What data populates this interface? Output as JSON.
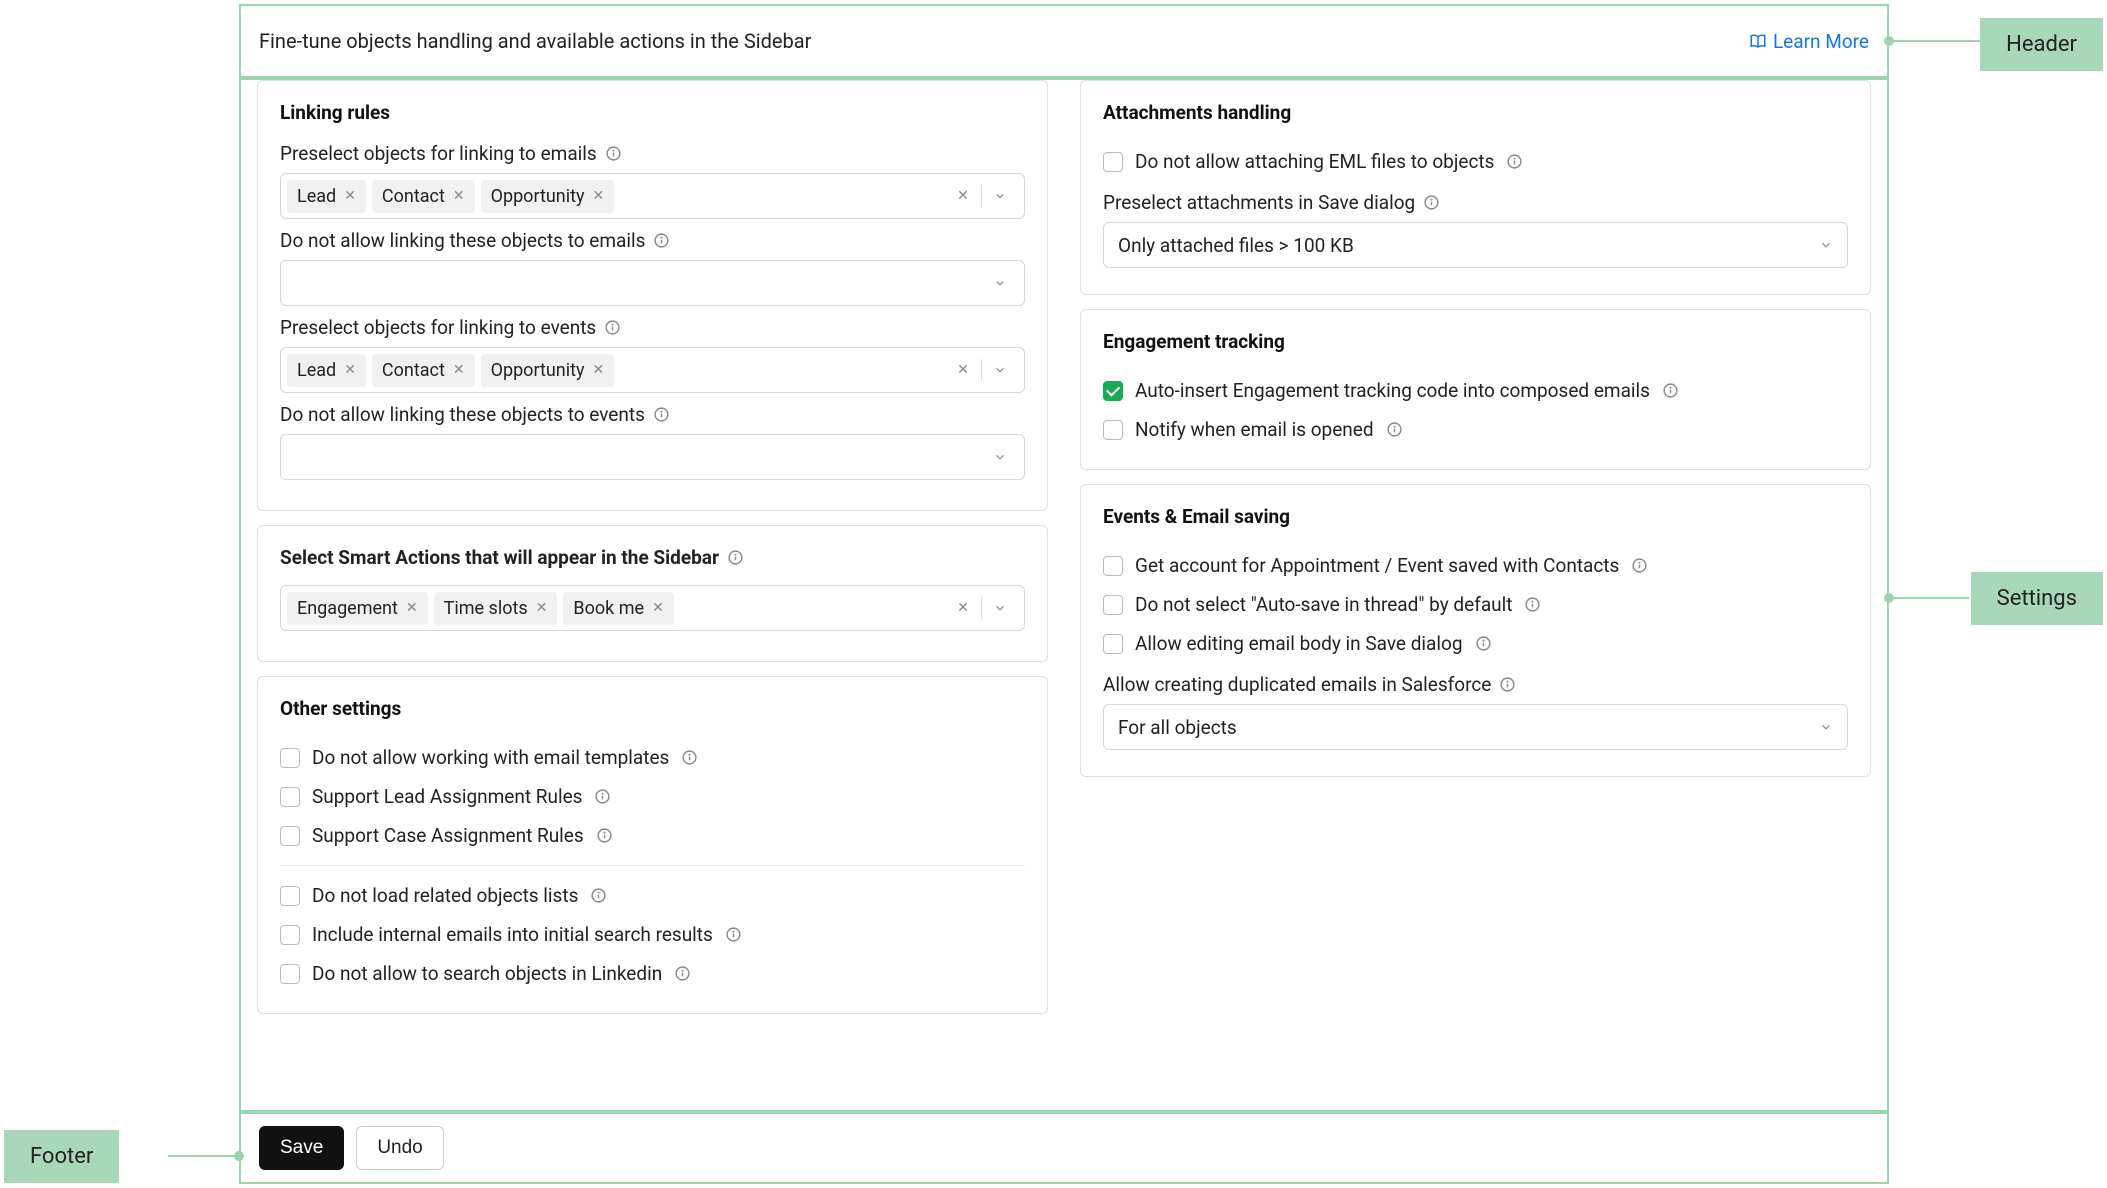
{
  "header": {
    "title": "Fine-tune objects handling and available actions in the Sidebar",
    "learn_more": "Learn More"
  },
  "callouts": {
    "header": "Header",
    "settings": "Settings",
    "footer": "Footer"
  },
  "linking": {
    "title": "Linking rules",
    "preselect_emails_label": "Preselect objects for linking to emails",
    "preselect_emails_tags": [
      "Lead",
      "Contact",
      "Opportunity"
    ],
    "disallow_emails_label": "Do not allow linking these objects to emails",
    "preselect_events_label": "Preselect objects for linking to events",
    "preselect_events_tags": [
      "Lead",
      "Contact",
      "Opportunity"
    ],
    "disallow_events_label": "Do not allow linking these objects to events"
  },
  "smart_actions": {
    "title": "Select Smart Actions that will appear in the Sidebar",
    "tags": [
      "Engagement",
      "Time slots",
      "Book me"
    ]
  },
  "other": {
    "title": "Other settings",
    "templates": "Do not allow working with email templates",
    "lead_rules": "Support Lead Assignment Rules",
    "case_rules": "Support Case Assignment Rules",
    "no_related": "Do not load related objects lists",
    "include_internal": "Include internal emails into initial search results",
    "no_linkedin": "Do not allow to search objects in Linkedin"
  },
  "attachments": {
    "title": "Attachments handling",
    "no_eml": "Do not allow attaching EML files to objects",
    "preselect_label": "Preselect attachments in Save dialog",
    "preselect_value": "Only attached files > 100 KB"
  },
  "engagement": {
    "title": "Engagement tracking",
    "auto_insert": "Auto-insert Engagement tracking code into composed emails",
    "notify_open": "Notify when email is opened"
  },
  "saving": {
    "title": "Events & Email saving",
    "get_account": "Get account for Appointment / Event saved with Contacts",
    "no_autosave": "Do not select \"Auto-save in thread\" by default",
    "allow_edit": "Allow editing email body in Save dialog",
    "dup_label": "Allow creating duplicated emails in Salesforce",
    "dup_value": "For all objects"
  },
  "footer": {
    "save": "Save",
    "undo": "Undo"
  }
}
